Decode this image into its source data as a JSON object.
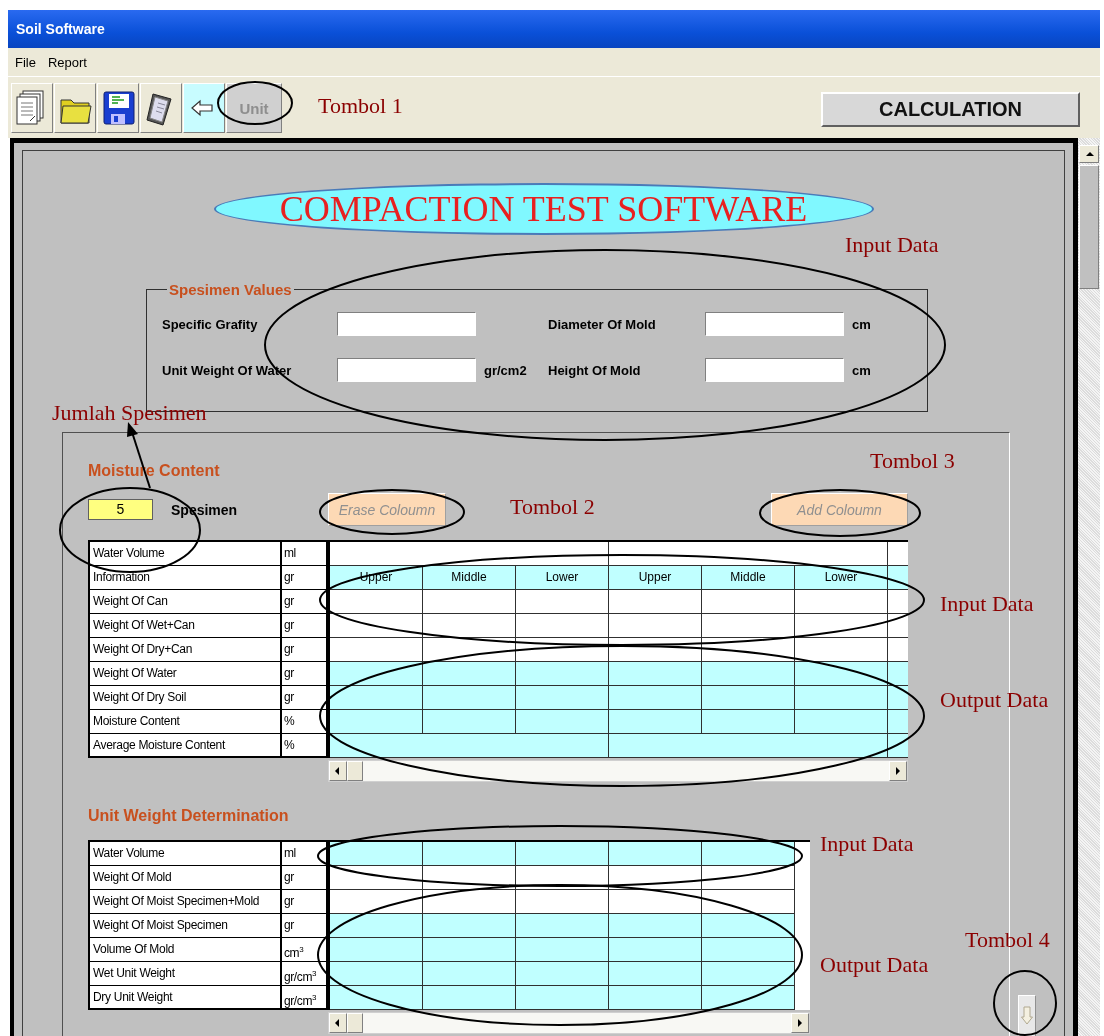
{
  "window": {
    "title": "Soil Software"
  },
  "menu": [
    {
      "label": "File"
    },
    {
      "label": "Report"
    }
  ],
  "toolbar": {
    "unit_button": {
      "label": "Unit",
      "disabled": true
    },
    "calculation_button": {
      "label": "CALCULATION"
    }
  },
  "app_title": "COMPACTION TEST SOFTWARE",
  "specimen_values": {
    "legend": "Spesimen Values",
    "fields": [
      {
        "label": "Specific Grafity"
      },
      {
        "label": "Diameter Of Mold",
        "unit": "cm"
      },
      {
        "label": "Unit Weight Of Water",
        "unit": "gr/cm2"
      },
      {
        "label": "Height Of Mold",
        "unit": "cm"
      }
    ]
  },
  "moisture_content": {
    "heading": "Moisture Content",
    "specimen_count": "5",
    "specimen_label": "Spesimen",
    "buttons": [
      {
        "label": "Erase Coloumn",
        "disabled": true
      },
      {
        "label": "Add Coloumn",
        "disabled": true
      }
    ],
    "column_labels": [
      "Upper",
      "Middle",
      "Lower",
      "Upper",
      "Middle",
      "Lower"
    ],
    "rows": [
      {
        "label": "Water Volume",
        "unit": "ml",
        "kind": "group"
      },
      {
        "label": "Information",
        "unit": "gr",
        "kind": "header"
      },
      {
        "label": "Weight Of Can",
        "unit": "gr",
        "kind": "input"
      },
      {
        "label": "Weight Of Wet+Can",
        "unit": "gr",
        "kind": "input"
      },
      {
        "label": "Weight Of Dry+Can",
        "unit": "gr",
        "kind": "input"
      },
      {
        "label": "Weight Of Water",
        "unit": "gr",
        "kind": "output"
      },
      {
        "label": "Weight Of Dry Soil",
        "unit": "gr",
        "kind": "output"
      },
      {
        "label": "Moisture Content",
        "unit": "%",
        "kind": "output"
      },
      {
        "label": "Average Moisture Content",
        "unit": "%",
        "kind": "group-output"
      }
    ]
  },
  "unit_weight": {
    "heading": "Unit Weight Determination",
    "rows": [
      {
        "label": "Water Volume",
        "unit": "ml",
        "kind": "output"
      },
      {
        "label": "Weight Of Mold",
        "unit": "gr",
        "kind": "input"
      },
      {
        "label": "Weight Of Moist Specimen+Mold",
        "unit": "gr",
        "kind": "input"
      },
      {
        "label": "Weight Of Moist Specimen",
        "unit": "gr",
        "kind": "output"
      },
      {
        "label": "Volume Of Mold",
        "unit": "cm$^{3}$",
        "kind": "output"
      },
      {
        "label": "Wet Unit Weight",
        "unit": "gr/cm$^{3}$",
        "kind": "output"
      },
      {
        "label": "Dry Unit Weight",
        "unit": "gr/cm$^{3}$",
        "kind": "output"
      }
    ]
  },
  "annotations": [
    {
      "text": "Tombol 1"
    },
    {
      "text": "Input Data"
    },
    {
      "text": "Jumlah Spesimen"
    },
    {
      "text": "Tombol 3"
    },
    {
      "text": "Tombol 2"
    },
    {
      "text": "Input Data"
    },
    {
      "text": "Output Data"
    },
    {
      "text": "Input Data"
    },
    {
      "text": "Tombol 4"
    },
    {
      "text": "Output Data"
    }
  ]
}
